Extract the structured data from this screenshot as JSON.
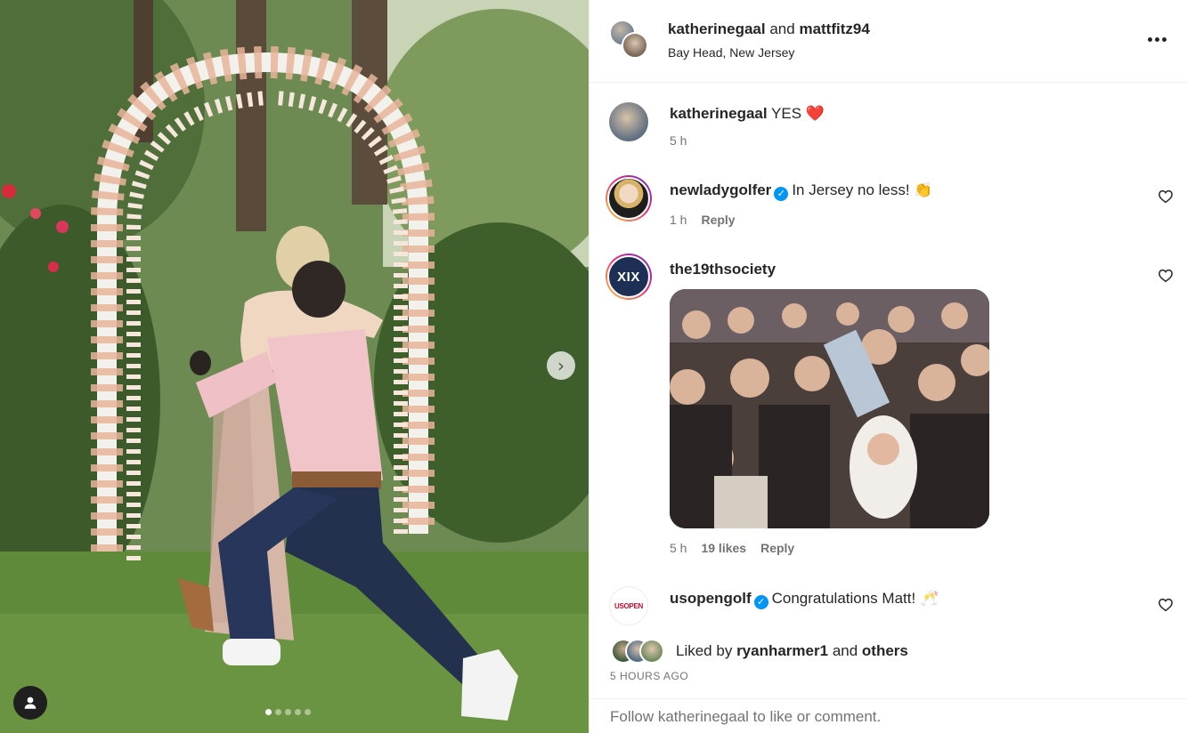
{
  "post": {
    "carousel": {
      "slide_count": 5,
      "active_index": 0,
      "next_icon": "chevron-right-icon",
      "tag_icon": "user-icon"
    },
    "header": {
      "author1": "katherinegaal",
      "joiner": "and",
      "author2": "mattfitz94",
      "location": "Bay Head, New Jersey",
      "more_icon": "more-horizontal-icon"
    },
    "comments": [
      {
        "username": "katherinegaal",
        "text": "YES",
        "emoji": "❤️",
        "time": "5 h",
        "verified": false,
        "reply": "",
        "likes": ""
      },
      {
        "username": "newladygolfer",
        "text": "In Jersey no less!",
        "emoji": "👏",
        "time": "1 h",
        "verified": true,
        "reply": "Reply",
        "likes": ""
      },
      {
        "username": "the19thsociety",
        "avatar_text": "XIX",
        "text": "",
        "time": "5 h",
        "verified": false,
        "reply": "Reply",
        "likes": "19 likes"
      },
      {
        "username": "usopengolf",
        "avatar_text": "USOPEN",
        "text": "Congratulations Matt!",
        "emoji": "🥂",
        "time": "",
        "verified": true
      }
    ],
    "likes": {
      "prefix": "Liked by",
      "user": "ryanharmer1",
      "joiner": "and",
      "others": "others"
    },
    "posted_ago": "5 HOURS AGO",
    "add_comment_prompt": "Follow katherinegaal to like or comment.",
    "colors": {
      "verified": "#0095f6",
      "heart": "#ed4956",
      "muted_text": "#737373",
      "text": "#262626"
    }
  }
}
